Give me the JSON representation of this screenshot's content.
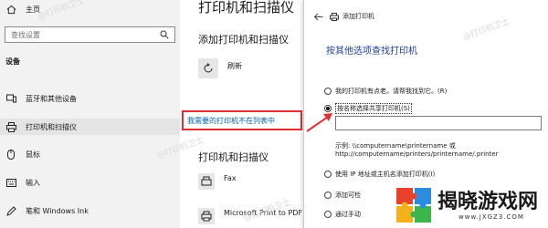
{
  "sidebar": {
    "home_label": "主页",
    "search_placeholder": "查找设置",
    "section_title": "设备",
    "items": [
      {
        "label": "蓝牙和其他设备",
        "icon": "bluetooth-devices-icon"
      },
      {
        "label": "打印机和扫描仪",
        "icon": "printer-icon"
      },
      {
        "label": "鼠标",
        "icon": "mouse-icon"
      },
      {
        "label": "输入",
        "icon": "keyboard-icon"
      },
      {
        "label": "笔和 Windows Ink",
        "icon": "pen-icon"
      }
    ]
  },
  "main": {
    "title": "打印机和扫描仪",
    "subtitle": "添加打印机和扫描仪",
    "refresh_label": "刷新",
    "not_listed_link": "我需要的打印机不在列表中",
    "section_title": "打印机和扫描仪",
    "printers": [
      {
        "name": "Fax"
      },
      {
        "name": "Microsoft Print to PDF"
      }
    ]
  },
  "dialog": {
    "header_title": "添加打印机",
    "heading": "按其他选项查找打印机",
    "options": [
      {
        "label": "我的打印机有点老。请帮我找到它。(R)",
        "selected": false
      },
      {
        "label": "按名称选择共享打印机(S)",
        "selected": true
      },
      {
        "label": "使用 IP 地址或主机名添加打印机(I)",
        "selected": false
      },
      {
        "label": "添加可检",
        "selected": false
      },
      {
        "label": "通过手动",
        "selected": false
      }
    ],
    "share_input_value": "",
    "example_line1": "示例: \\\\computername\\printername 或",
    "example_line2": "http://computername/printers/printername/.printer"
  },
  "watermarks": [
    "@打印机卫士",
    "@打印机卫士",
    "@打印机卫士",
    "@打印机卫士"
  ],
  "brand": {
    "name": "揭晓游戏网",
    "site": "www.JXGZ3.COM"
  },
  "colors": {
    "link": "#0063b1",
    "highlight_border": "#e03030",
    "dialog_heading": "#1f3f99",
    "sidebar_bg": "#f2f2f2"
  }
}
